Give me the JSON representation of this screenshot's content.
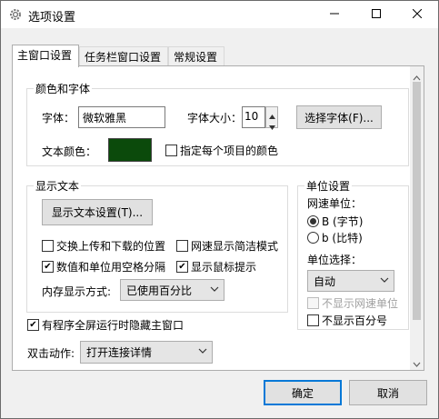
{
  "window": {
    "title": "选项设置"
  },
  "tabs": [
    {
      "label": "主窗口设置",
      "active": true
    },
    {
      "label": "任务栏窗口设置",
      "active": false
    },
    {
      "label": "常规设置",
      "active": false
    }
  ],
  "color_font": {
    "legend": "颜色和字体",
    "font_label": "字体：",
    "font_value": "微软雅黑",
    "font_size_label": "字体大小：",
    "font_size_value": "10",
    "choose_font_button": "选择字体(F)...",
    "text_color_label": "文本颜色：",
    "text_color": "#0b4a0b",
    "per_item_color_label": "指定每个项目的颜色",
    "per_item_color_checked": false
  },
  "display_text": {
    "legend": "显示文本",
    "settings_button": "显示文本设置(T)...",
    "swap_updown_label": "交换上传和下载的位置",
    "swap_updown_checked": false,
    "simple_mode_label": "网速显示简洁模式",
    "simple_mode_checked": false,
    "space_sep_label": "数值和单位用空格分隔",
    "space_sep_checked": true,
    "mouse_tip_label": "显示鼠标提示",
    "mouse_tip_checked": true,
    "memory_mode_label": "内存显示方式:",
    "memory_mode_value": "已使用百分比"
  },
  "units": {
    "legend": "单位设置",
    "speed_unit_label": "网速单位：",
    "option_b_label": "B (字节)",
    "option_b_selected": true,
    "option_bit_label": "b (比特)",
    "option_bit_selected": false,
    "unit_select_label": "单位选择：",
    "unit_select_value": "自动",
    "hide_speed_unit_label": "不显示网速单位",
    "hide_speed_unit_checked": false,
    "hide_percent_label": "不显示百分号",
    "hide_percent_checked": false
  },
  "hide_on_fullscreen_label": "有程序全屏运行时隐藏主窗口",
  "hide_on_fullscreen_checked": true,
  "double_click_label": "双击动作:",
  "double_click_value": "打开连接详情",
  "footer": {
    "ok_label": "确定",
    "cancel_label": "取消"
  }
}
